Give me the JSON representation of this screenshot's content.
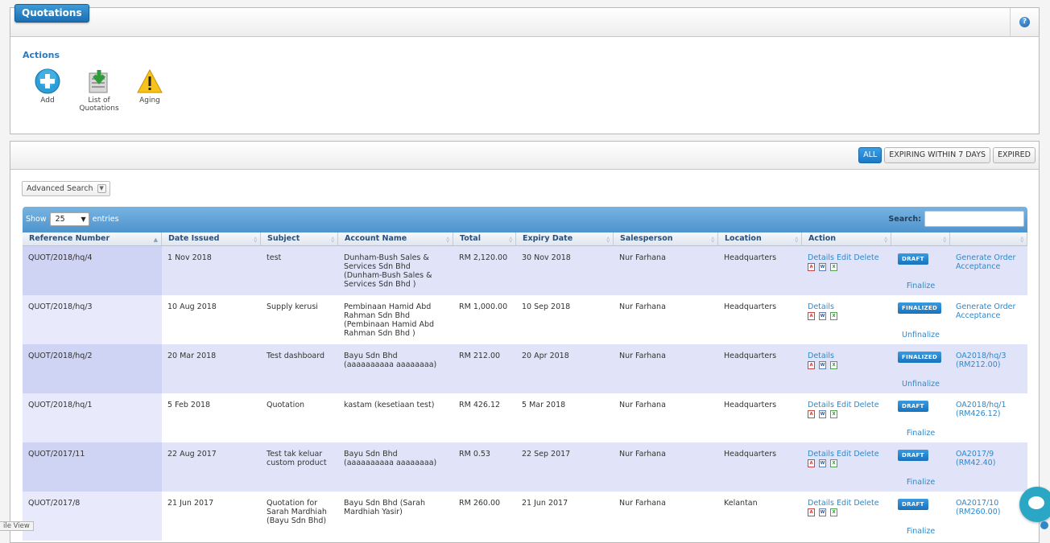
{
  "page": {
    "title": "Quotations",
    "help_icon": "question-icon"
  },
  "actions": {
    "title": "Actions",
    "items": [
      {
        "label": "Add",
        "icon": "add-plus-icon"
      },
      {
        "label_line1": "List of",
        "label_line2": "Quotations",
        "icon": "download-list-icon"
      },
      {
        "label": "Aging",
        "icon": "warning-icon"
      }
    ]
  },
  "filters": {
    "all": "ALL",
    "expiring": "EXPIRING WITHIN 7 DAYS",
    "expired": "EXPIRED"
  },
  "advanced_search": "Advanced Search",
  "table_controls": {
    "show": "Show",
    "entries_value": "25",
    "entries": "entries",
    "search": "Search:"
  },
  "columns": [
    "Reference Number",
    "Date Issued",
    "Subject",
    "Account Name",
    "Total",
    "Expiry Date",
    "Salesperson",
    "Location",
    "Action",
    "",
    ""
  ],
  "rows": [
    {
      "ref": "QUOT/2018/hq/4",
      "date": "1 Nov 2018",
      "subject": "test",
      "account": "Dunham-Bush Sales & Services Sdn Bhd (Dunham-Bush Sales & Services Sdn Bhd )",
      "total": "RM 2,120.00",
      "expiry": "30 Nov 2018",
      "salesperson": "Nur Farhana",
      "location": "Headquarters",
      "details": "Details",
      "edit": "Edit",
      "delete": "Delete",
      "status": "DRAFT",
      "status_action": "Finalize",
      "link": "Generate Order Acceptance"
    },
    {
      "ref": "QUOT/2018/hq/3",
      "date": "10 Aug 2018",
      "subject": "Supply kerusi",
      "account": "Pembinaan Hamid Abd Rahman Sdn Bhd (Pembinaan Hamid Abd Rahman Sdn Bhd )",
      "total": "RM 1,000.00",
      "expiry": "10 Sep 2018",
      "salesperson": "Nur Farhana",
      "location": "Headquarters",
      "details": "Details",
      "edit": "",
      "delete": "",
      "status": "FINALIZED",
      "status_action": "Unfinalize",
      "link": "Generate Order Acceptance"
    },
    {
      "ref": "QUOT/2018/hq/2",
      "date": "20 Mar 2018",
      "subject": "Test dashboard",
      "account": "Bayu Sdn Bhd (aaaaaaaaaa aaaaaaaa)",
      "total": "RM 212.00",
      "expiry": "20 Apr 2018",
      "salesperson": "Nur Farhana",
      "location": "Headquarters",
      "details": "Details",
      "edit": "",
      "delete": "",
      "status": "FINALIZED",
      "status_action": "Unfinalize",
      "link": "OA2018/hq/3 (RM212.00)"
    },
    {
      "ref": "QUOT/2018/hq/1",
      "date": "5 Feb 2018",
      "subject": "Quotation",
      "account": "kastam (kesetiaan test)",
      "total": "RM 426.12",
      "expiry": "5 Mar 2018",
      "salesperson": "Nur Farhana",
      "location": "Headquarters",
      "details": "Details",
      "edit": "Edit",
      "delete": "Delete",
      "status": "DRAFT",
      "status_action": "Finalize",
      "link": "OA2018/hq/1 (RM426.12)"
    },
    {
      "ref": "QUOT/2017/11",
      "date": "22 Aug 2017",
      "subject": "Test tak keluar custom product",
      "account": "Bayu Sdn Bhd (aaaaaaaaaa aaaaaaaa)",
      "total": "RM 0.53",
      "expiry": "22 Sep 2017",
      "salesperson": "Nur Farhana",
      "location": "Headquarters",
      "details": "Details",
      "edit": "Edit",
      "delete": "Delete",
      "status": "DRAFT",
      "status_action": "Finalize",
      "link": "OA2017/9 (RM42.40)"
    },
    {
      "ref": "QUOT/2017/8",
      "date": "21 Jun 2017",
      "subject": "Quotation for Sarah Mardhiah (Bayu Sdn Bhd)",
      "account": "Bayu Sdn Bhd (Sarah Mardhiah Yasir)",
      "total": "RM 260.00",
      "expiry": "21 Jun 2017",
      "salesperson": "Nur Farhana",
      "location": "Kelantan",
      "details": "Details",
      "edit": "Edit",
      "delete": "Delete",
      "status": "DRAFT",
      "status_action": "Finalize",
      "link": "OA2017/10 (RM260.00)"
    }
  ],
  "footer": {
    "mobile_view": "ile View"
  },
  "colors": {
    "accent": "#2f87c8",
    "odd_row": "#e1e4f8",
    "ref_col_odd": "#cfd3f4"
  }
}
